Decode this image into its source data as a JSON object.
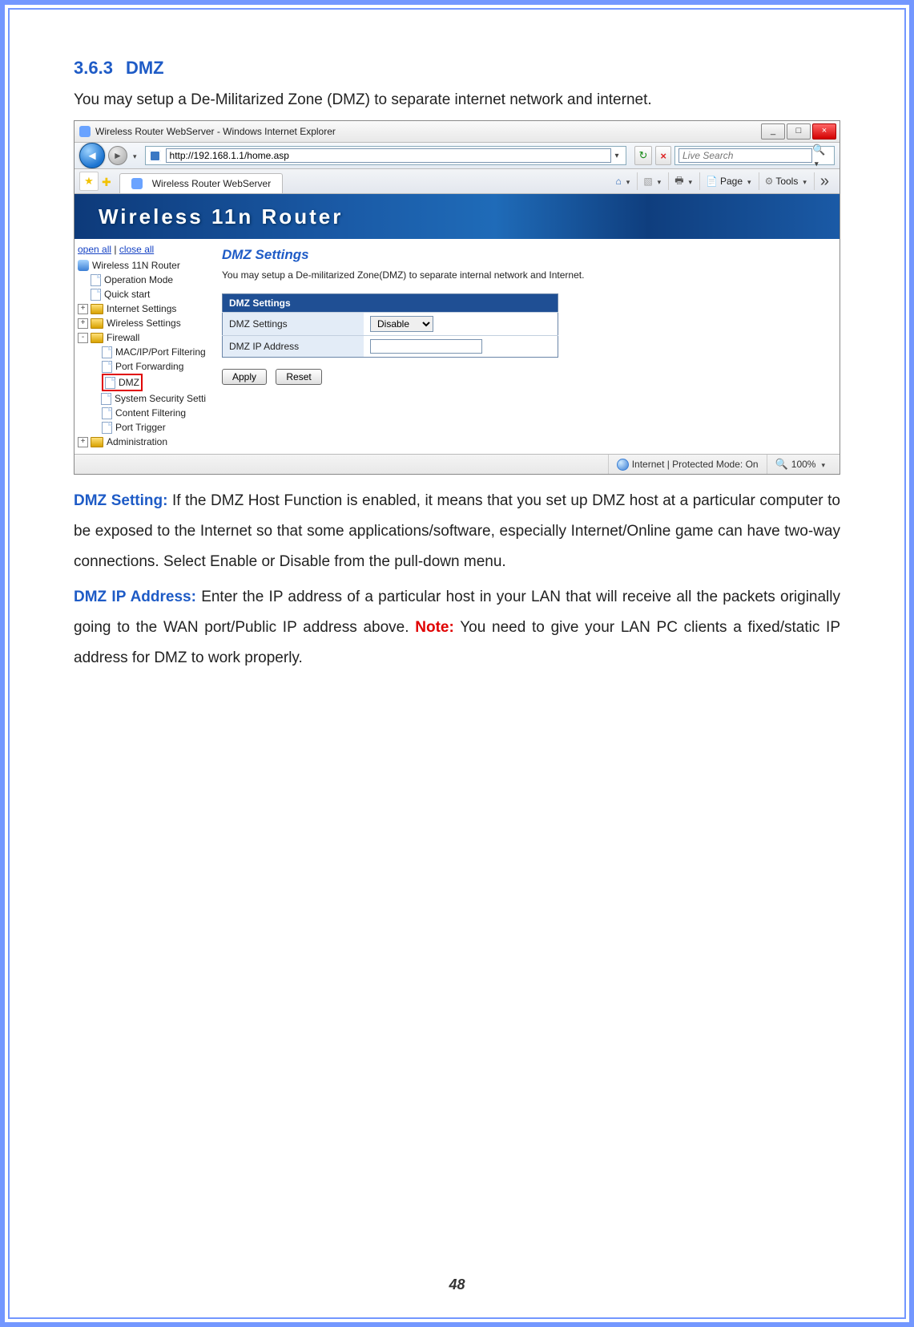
{
  "doc": {
    "heading_num": "3.6.3",
    "heading_text": "DMZ",
    "intro": "You may setup a De-Militarized Zone (DMZ) to separate internet network and internet.",
    "dmz_setting_label": "DMZ Setting:",
    "dmz_setting_text": " If the DMZ Host Function is enabled, it means that you set up DMZ host at a particular computer to be exposed to the Internet so that some applications/software, especially Internet/Online game can have two-way connections. Select Enable or Disable from the pull-down menu.",
    "dmz_ip_label": "DMZ IP Address:",
    "dmz_ip_text": " Enter the IP address of a particular host in your LAN that will receive all the packets originally going to the WAN port/Public IP address above.   ",
    "note_label": "Note:",
    "note_text": " You need to give your LAN PC clients a fixed/static IP address for DMZ to work properly.",
    "page_number": "48"
  },
  "ie": {
    "title": "Wireless Router WebServer - Windows Internet Explorer",
    "url": "http://192.168.1.1/home.asp",
    "search_placeholder": "Live Search",
    "tab_title": "Wireless Router WebServer",
    "cmd_page": "Page",
    "cmd_tools": "Tools",
    "status_text": "Internet | Protected Mode: On",
    "zoom": "100%",
    "min_label": "_",
    "max_label": "□",
    "close_label": "×",
    "banner_text": "Wireless  11n  Router"
  },
  "panel": {
    "open_all": "open all",
    "close_all": "close all"
  },
  "tree": {
    "root": "Wireless 11N Router",
    "op_mode": "Operation Mode",
    "quick_start": "Quick start",
    "internet": "Internet Settings",
    "wireless": "Wireless Settings",
    "firewall": "Firewall",
    "fw_mac": "MAC/IP/Port Filtering",
    "fw_portfwd": "Port Forwarding",
    "fw_dmz": "DMZ",
    "fw_sys": "System Security Setti",
    "fw_content": "Content Filtering",
    "fw_trigger": "Port Trigger",
    "admin": "Administration"
  },
  "page": {
    "title": "DMZ Settings",
    "desc": "You may setup a De-militarized Zone(DMZ) to separate internal network and Internet.",
    "tbl_header": "DMZ Settings",
    "row1_label": "DMZ Settings",
    "row1_value": "Disable",
    "row2_label": "DMZ IP Address",
    "apply": "Apply",
    "reset": "Reset"
  }
}
